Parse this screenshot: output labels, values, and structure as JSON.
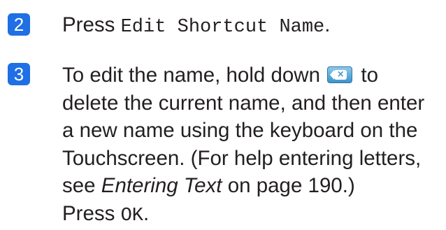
{
  "steps": [
    {
      "number": "2",
      "lines": [
        {
          "pre": "Press ",
          "code": "Edit Shortcut Name",
          "post": "."
        }
      ]
    },
    {
      "number": "3",
      "line1_pre": "To edit the name, hold down ",
      "line1_post": " to",
      "key_icon": "backspace-key-icon",
      "line2": "delete the current name, and then enter",
      "line3": "a new name using the keyboard on the",
      "line4": "Touchscreen. (For help entering letters,",
      "line5_pre": "see ",
      "line5_em": "Entering Text",
      "line5_post": " on page 190.)",
      "line6_pre": "Press ",
      "line6_code": "OK",
      "line6_post": "."
    }
  ],
  "colors": {
    "step_badge": "#1f6fe5",
    "text": "#231f20",
    "key_icon": "#3b93cc"
  }
}
